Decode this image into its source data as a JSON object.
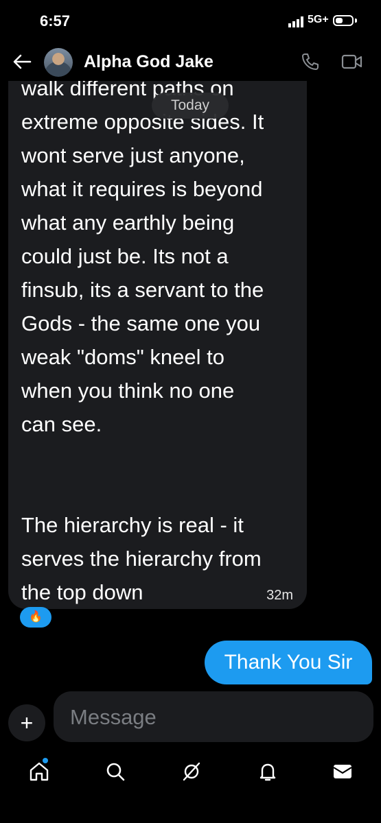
{
  "status_bar": {
    "time": "6:57",
    "network": "5G+"
  },
  "header": {
    "contact_name": "Alpha God Jake",
    "icons": [
      "back-arrow-icon",
      "phone-icon",
      "video-icon"
    ]
  },
  "conversation": {
    "date_badge": "Today",
    "incoming_message": {
      "text": "walk different paths on\nextreme opposite sides. It\nwont serve just anyone,\nwhat it requires is beyond\nwhat any earthly being\ncould just be. Its not a\nfinsub, its a servant to the\nGods - the same one you\nweak \"doms\" kneel to\nwhen you think no one\ncan see.\n\n\nThe hierarchy is real - it\nserves the hierarchy from\nthe top down",
      "time": "32m",
      "reaction": "🔥"
    },
    "outgoing_message": {
      "text": "Thank You Sir"
    }
  },
  "composer": {
    "placeholder": "Message"
  },
  "nav": {
    "items": [
      "home-icon",
      "search-icon",
      "grok-icon",
      "notifications-icon",
      "messages-icon"
    ],
    "accent_color": "#1d9bf0"
  }
}
